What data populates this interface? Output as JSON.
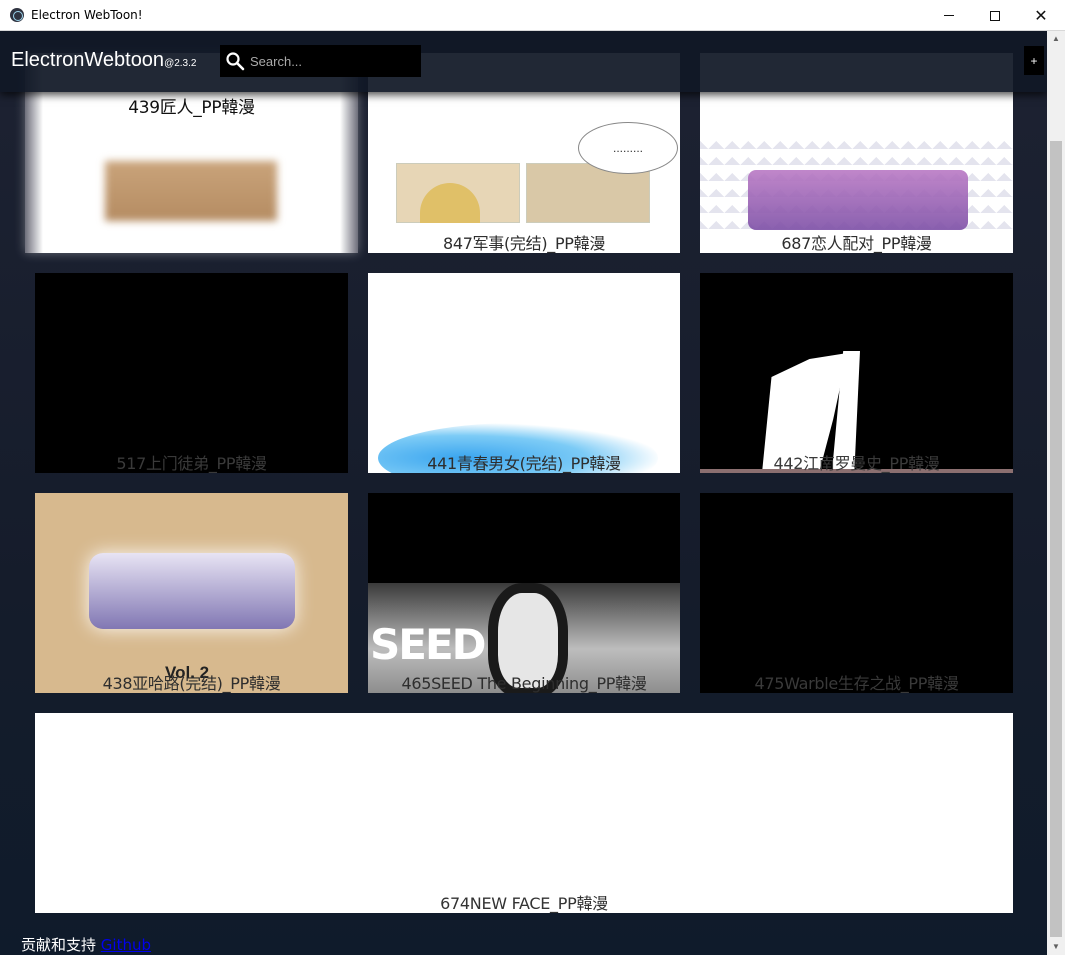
{
  "window": {
    "title": "Electron WebToon!",
    "minimize_glyph": "",
    "maximize_glyph": "",
    "close_glyph": "✕"
  },
  "header": {
    "brand": "ElectronWebtoon",
    "version": "@2.3.2",
    "search_placeholder": "Search...",
    "add_label": "+"
  },
  "cards": [
    {
      "title": "439匠人_PP韓漫"
    },
    {
      "title": "847军事(完结)_PP韓漫",
      "bubble": "........."
    },
    {
      "title": "687恋人配对_PP韓漫"
    },
    {
      "title": "517上门徒弟_PP韓漫"
    },
    {
      "title": "441青春男女(完结)_PP韓漫"
    },
    {
      "title": "442江南罗曼史_PP韓漫"
    },
    {
      "title": "438亚哈路(完结)_PP韓漫",
      "art_text": "Vol. 2"
    },
    {
      "title": "465SEED The Beginning_PP韓漫",
      "art_text": "SEED"
    },
    {
      "title": "475Warble生存之战_PP韓漫"
    },
    {
      "title": "674NEW FACE_PP韓漫"
    }
  ],
  "footer": {
    "text": "贡献和支持",
    "link": "Github"
  },
  "colors": {
    "background": "#1f2433",
    "header": "#101826",
    "link": "#0000ee"
  }
}
